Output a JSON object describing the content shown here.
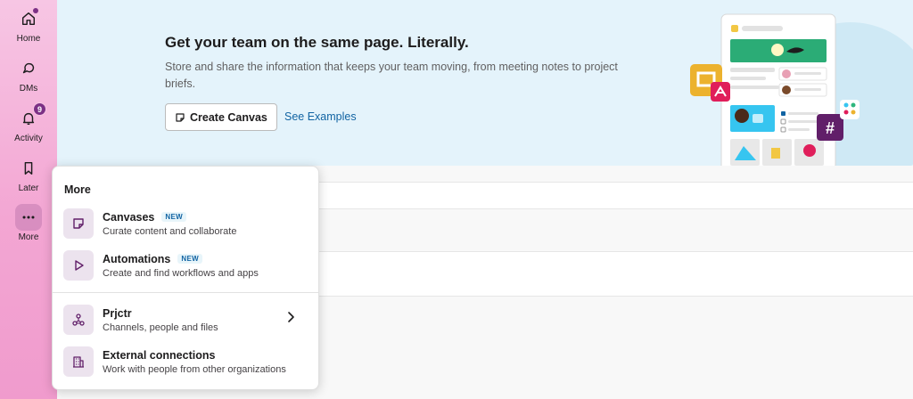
{
  "rail": {
    "items": [
      {
        "label": "Home",
        "icon": "home-icon"
      },
      {
        "label": "DMs",
        "icon": "dms-icon"
      },
      {
        "label": "Activity",
        "icon": "bell-icon",
        "badge": "9"
      },
      {
        "label": "Later",
        "icon": "bookmark-icon"
      },
      {
        "label": "More",
        "icon": "more-icon"
      }
    ]
  },
  "banner": {
    "title": "Get your team on the same page. Literally.",
    "description": "Store and share the information that keeps your team moving, from meeting notes to project briefs.",
    "create_button": "Create Canvas",
    "see_examples": "See Examples"
  },
  "more_menu": {
    "title": "More",
    "items": [
      {
        "name": "Canvases",
        "badge": "NEW",
        "sub": "Curate content and collaborate",
        "icon": "canvas-icon"
      },
      {
        "name": "Automations",
        "badge": "NEW",
        "sub": "Create and find workflows and apps",
        "icon": "play-icon"
      },
      {
        "name": "Prjctr",
        "sub": "Channels, people and files",
        "icon": "workspace-icon"
      },
      {
        "name": "External connections",
        "sub": "Work with people from other organizations",
        "icon": "building-icon"
      }
    ]
  },
  "colors": {
    "rail_top": "#f7c6e4",
    "rail_bottom": "#f09bcd",
    "accent_purple": "#7c3085",
    "link_blue": "#1264a3",
    "banner_bg": "#e4f3fb"
  }
}
